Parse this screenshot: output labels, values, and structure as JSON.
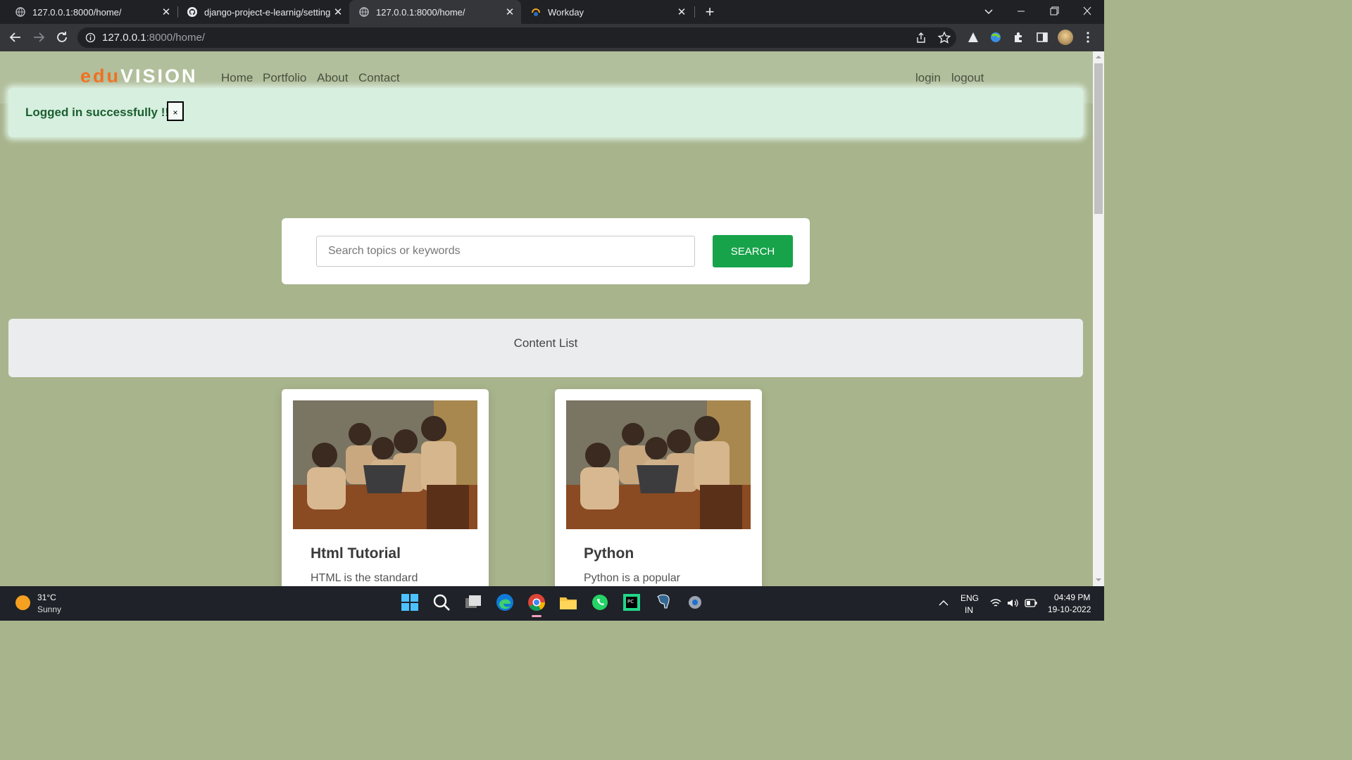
{
  "browser": {
    "tabs": [
      {
        "title": "127.0.0.1:8000/home/",
        "favicon": "globe-icon",
        "active": false
      },
      {
        "title": "django-project-e-learnig/settings",
        "favicon": "github-icon",
        "active": false
      },
      {
        "title": "127.0.0.1:8000/home/",
        "favicon": "globe-icon",
        "active": true
      },
      {
        "title": "Workday",
        "favicon": "workday-icon",
        "active": false
      }
    ],
    "close_glyph": "✕",
    "new_tab_glyph": "+",
    "url_host": "127.0.0.1",
    "url_rest": ":8000/home/"
  },
  "site": {
    "brand_a": "edu",
    "brand_b": "VISION",
    "nav": [
      "Home",
      "Portfolio",
      "About",
      "Contact"
    ],
    "auth": [
      "login",
      "logout"
    ],
    "alert_text": "Logged in successfully !!",
    "alert_close": "×",
    "search_placeholder": "Search topics or keywords",
    "search_button": "SEARCH",
    "content_list_title": "Content List",
    "cards": [
      {
        "title": "Html Tutorial",
        "desc": "HTML is the standard"
      },
      {
        "title": "Python",
        "desc": "Python is a popular"
      }
    ]
  },
  "taskbar": {
    "weather_temp": "31°C",
    "weather_desc": "Sunny",
    "lang_line1": "ENG",
    "lang_line2": "IN",
    "time": "04:49 PM",
    "date": "19-10-2022"
  },
  "colors": {
    "page_bg": "#a8b48c",
    "brand_orange": "#f07020",
    "search_green": "#17a34a",
    "alert_bg": "#d6efdf"
  }
}
